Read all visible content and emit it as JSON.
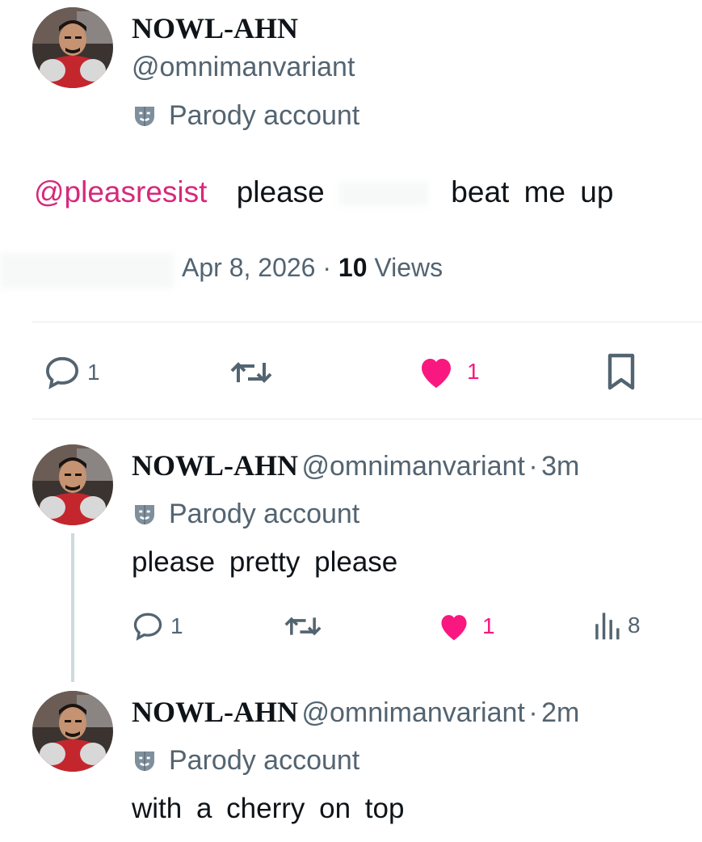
{
  "main_tweet": {
    "display_name": "NOWL-AHN",
    "handle": "@omnimanvariant",
    "parody_label": "Parody account",
    "mention": "@pleasresist",
    "text_part1": "please",
    "text_part2": "beat me up",
    "date": "Apr 8, 2026",
    "separator": "·",
    "views_count": "10",
    "views_label": "Views",
    "reply_count": "1",
    "like_count": "1",
    "like_color": "#f91880"
  },
  "replies": [
    {
      "display_name": "NOWL-AHN",
      "handle": "@omnimanvariant",
      "time": "3m",
      "separator": "·",
      "parody_label": "Parody account",
      "text": "please pretty please",
      "reply_count": "1",
      "like_count": "1",
      "view_count": "8"
    },
    {
      "display_name": "NOWL-AHN",
      "handle": "@omnimanvariant",
      "time": "2m",
      "separator": "·",
      "parody_label": "Parody account",
      "text": "with a cherry on top"
    }
  ],
  "colors": {
    "mention": "#d6297c",
    "like": "#f91880",
    "secondary": "#536471"
  }
}
